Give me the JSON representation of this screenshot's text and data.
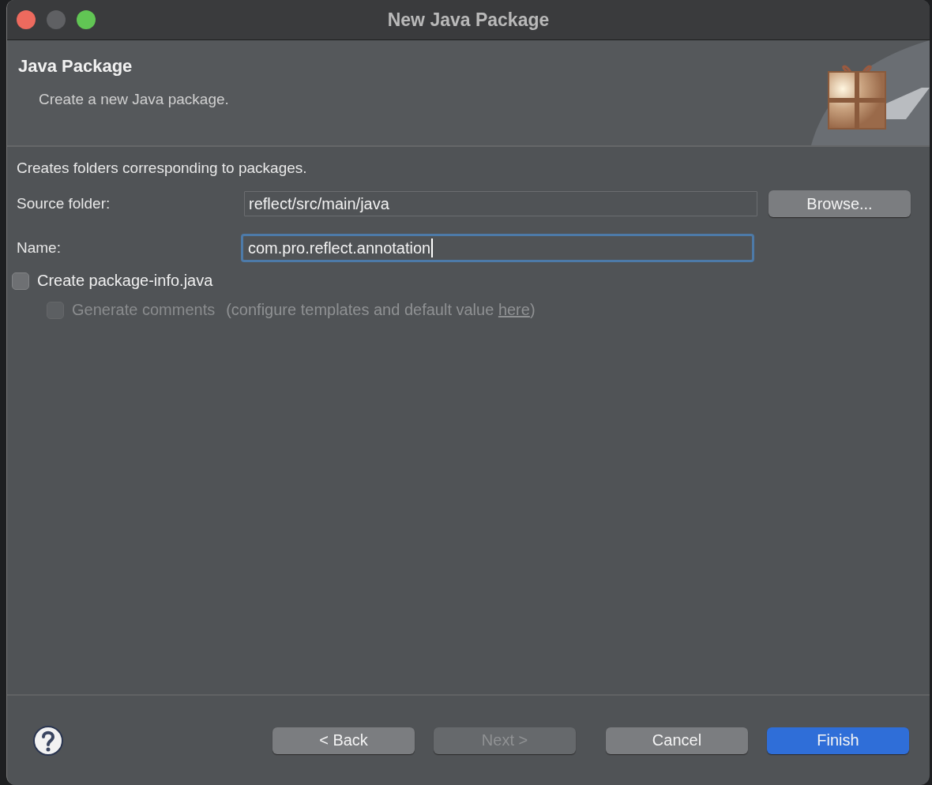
{
  "window": {
    "title": "New Java Package"
  },
  "header": {
    "title": "Java Package",
    "subtitle": "Create a new Java package."
  },
  "description": "Creates folders corresponding to packages.",
  "fields": [
    {
      "label": "Source folder:",
      "value": "reflect/src/main/java",
      "focused": false,
      "button": "Browse..."
    },
    {
      "label": "Name:",
      "value": "com.pro.reflect.annotation",
      "focused": true
    }
  ],
  "checkboxes": [
    {
      "label": "Create package-info.java",
      "checked": false,
      "disabled": false
    },
    {
      "label": "Generate comments",
      "checked": false,
      "disabled": true,
      "hint_before": "(configure templates and default value ",
      "hint_link": "here",
      "hint_after": ")"
    }
  ],
  "buttons": [
    {
      "label": "< Back",
      "disabled": false,
      "default": false
    },
    {
      "label": "Next >",
      "disabled": true,
      "default": false
    },
    {
      "label": "Cancel",
      "disabled": false,
      "default": false
    },
    {
      "label": "Finish",
      "disabled": false,
      "default": true
    }
  ]
}
